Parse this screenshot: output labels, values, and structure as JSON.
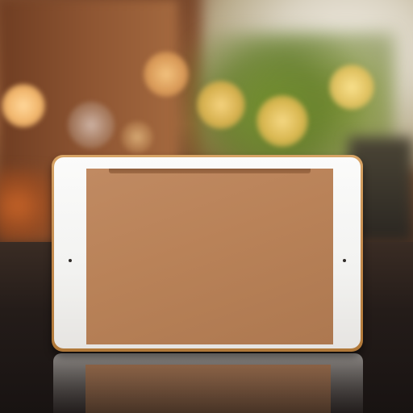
{
  "scene": {
    "subject": "tablet",
    "background": "blurred-bokeh-interior",
    "colors": {
      "device_frame": "#f5f5f3",
      "device_edge": "#c48a4c",
      "screen": "#b98258",
      "bokeh_warm": "#f4c27c",
      "greenery": "#7f9a2e"
    }
  }
}
